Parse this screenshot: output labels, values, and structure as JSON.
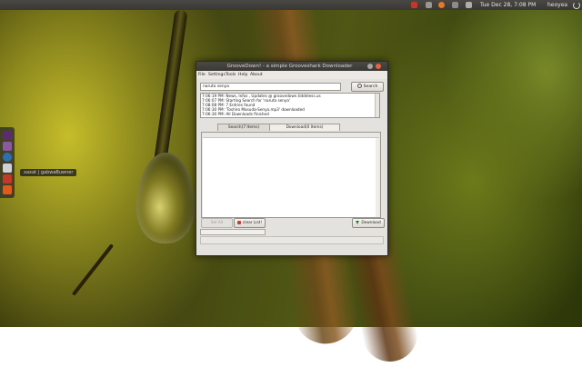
{
  "panel": {
    "clock": "Tue Dec 28, 7:08 PM",
    "user": "heoyea",
    "icons": [
      "mail-icon",
      "network-icon",
      "firefox-icon",
      "power-icon"
    ]
  },
  "launcher": {
    "tooltip": "xaxat | gabwaBuwner",
    "icons": [
      "home-folder-icon",
      "files-icon",
      "firefox-icon",
      "ubuntu-icon",
      "settings-icon",
      "software-center-icon"
    ]
  },
  "window": {
    "title": "GrooveDown! - a simple Grooveshark Downloader",
    "menu": [
      "File",
      "Settings",
      "Tools",
      "Help",
      "About"
    ],
    "search": {
      "value": "naruto senya",
      "button": "Search"
    },
    "log": [
      "7:06:19 PM: News, Infos , Updates @ groovedown.tiddeless.us",
      "7:06:07 PM: Starting Search for 'naruto senya'",
      "7:08:08 PM: 7 Entries found",
      "7:06:30 PM: 'Toshiro Masuda-Senya.mp3' downloaded",
      "7:06:30 PM: All Downloads finished"
    ],
    "tabs": {
      "search": "Search(7 Items)",
      "download": "Download(0 Items)"
    },
    "buttons": {
      "select_all": "Sel All",
      "clear_list": "clear List!",
      "download": "Download"
    },
    "progress": 0
  },
  "colors": {
    "accent": "#7a9ed8",
    "clear_icon": "#d03a2a",
    "download_icon": "#2f7f2a"
  }
}
